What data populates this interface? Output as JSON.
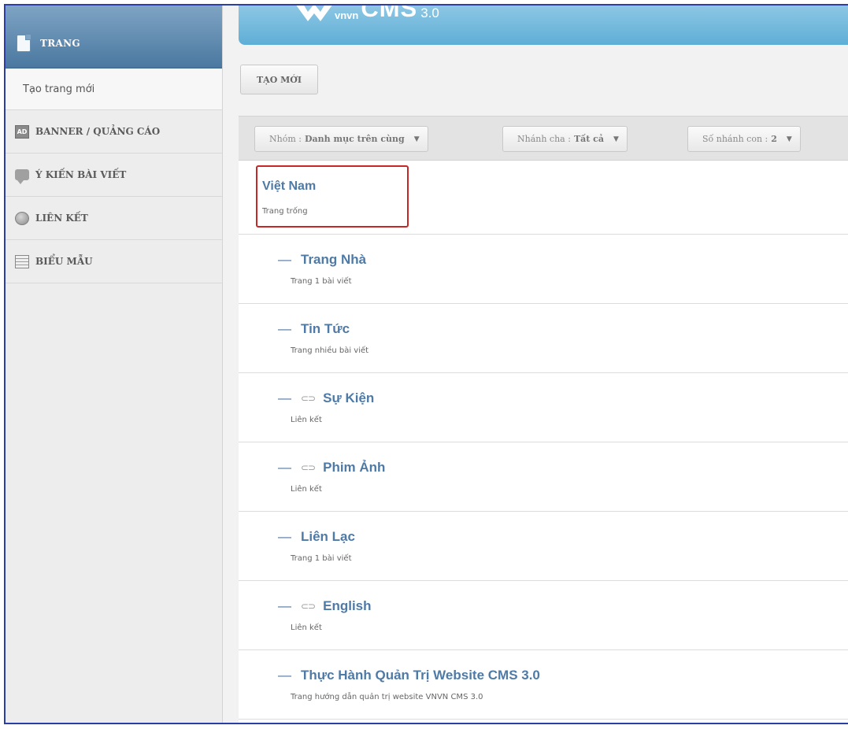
{
  "sidebar": {
    "header": "TRANG",
    "sub_item": "Tạo trang mới",
    "items": [
      {
        "label": "BANNER / QUẢNG CÁO",
        "icon": "banner-icon"
      },
      {
        "label": "Ý KIẾN BÀI VIẾT",
        "icon": "comment-icon"
      },
      {
        "label": "LIÊN KẾT",
        "icon": "globe-icon"
      },
      {
        "label": "BIỂU MẪU",
        "icon": "form-icon"
      }
    ],
    "banner_icon_text": "AD"
  },
  "header": {
    "logo_small": "vnvn",
    "logo_big": "CMS",
    "logo_version": "3.0"
  },
  "toolbar": {
    "new_label": "TẠO MỚI"
  },
  "filters": [
    {
      "label": "Nhóm :",
      "value": "Danh mục trên cùng"
    },
    {
      "label": "Nhánh cha :",
      "value": "Tất cả"
    },
    {
      "label": "Số nhánh con :",
      "value": "2"
    }
  ],
  "pages": [
    {
      "title": "Việt Nam",
      "subtitle": "Trang trống",
      "level": 0,
      "link": false
    },
    {
      "title": "Trang Nhà",
      "subtitle": "Trang 1 bài viết",
      "level": 1,
      "link": false
    },
    {
      "title": "Tin Tức",
      "subtitle": "Trang nhiều bài viết",
      "level": 1,
      "link": false
    },
    {
      "title": "Sự Kiện",
      "subtitle": "Liên kết",
      "level": 1,
      "link": true
    },
    {
      "title": "Phim Ảnh",
      "subtitle": "Liên kết",
      "level": 1,
      "link": true
    },
    {
      "title": "Liên Lạc",
      "subtitle": "Trang 1 bài viết",
      "level": 1,
      "link": false
    },
    {
      "title": "English",
      "subtitle": "Liên kết",
      "level": 1,
      "link": true
    },
    {
      "title": "Thực Hành Quản Trị Website CMS 3.0",
      "subtitle": "Trang hướng dẫn quản trị website VNVN CMS 3.0",
      "level": 1,
      "link": false
    }
  ],
  "symbols": {
    "dash": "—",
    "link": "⊂⊃",
    "caret": "▼"
  },
  "colors": {
    "accent": "#4f7aa6",
    "highlight": "#c62828",
    "banner": "#6fb8dc"
  }
}
